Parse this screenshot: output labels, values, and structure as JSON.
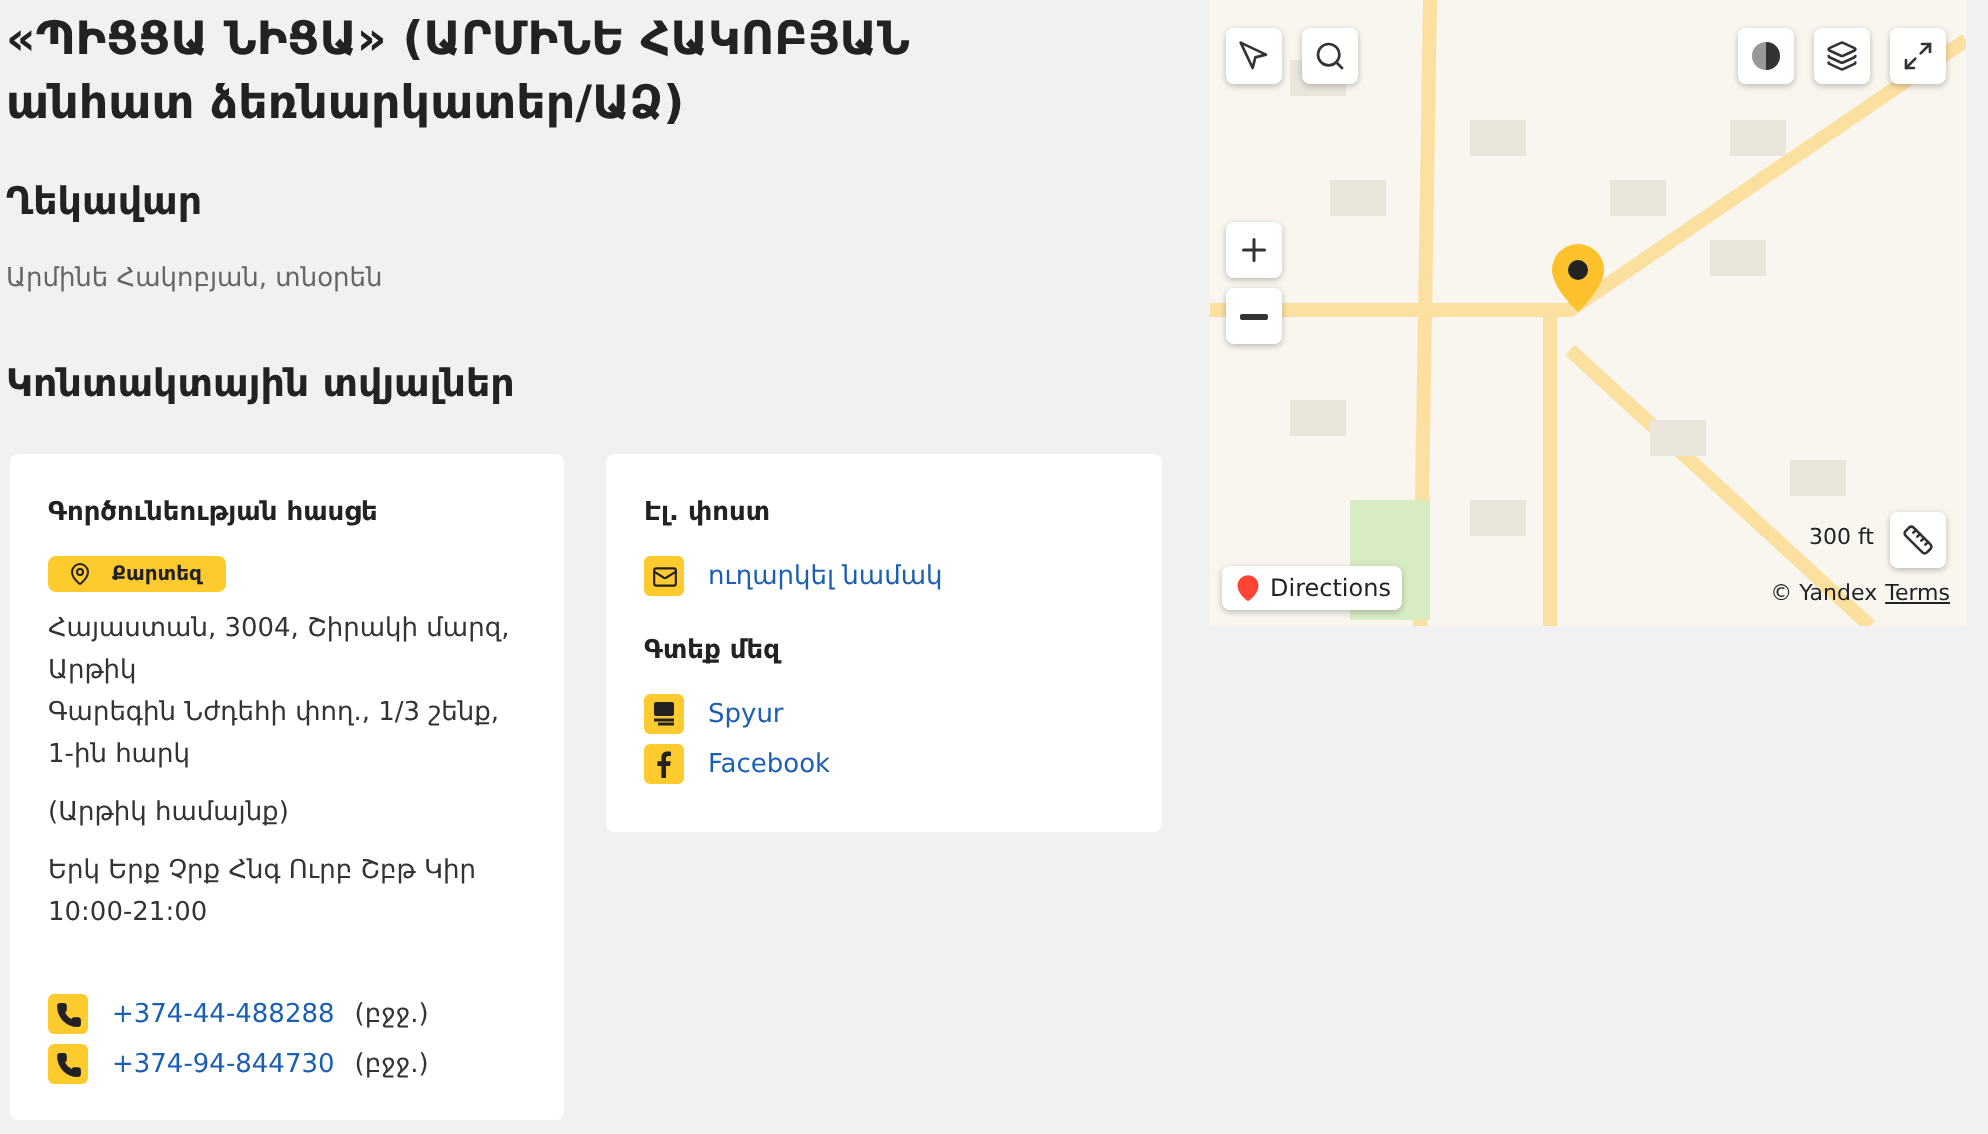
{
  "title": "«ՊԻՑՑԱ ՆԻՑԱ» (ԱՐՄԻՆԵ ՀԱԿՈԲՅԱՆ անհատ ձեռնարկատեր/ԱՁ)",
  "manager": {
    "heading": "Ղեկավար",
    "name": "Արմինե Հակոբյան, տնօրեն"
  },
  "contacts_heading": "Կոնտակտային տվյալներ",
  "address_card": {
    "heading": "Գործունեության հասցե",
    "map_button": "Քարտեզ",
    "address_lines": [
      "Հայաստան, 3004, Շիրակի մարզ, Արթիկ",
      "Գարեգին Նժդեհի փող., 1/3 շենք, 1-ին հարկ"
    ],
    "community": "(Արթիկ համայնք)",
    "days": "Երկ Երք Չրք Հնգ Ուրբ Շբթ Կիր",
    "hours": "10:00-21:00",
    "phones": [
      {
        "number": "+374-44-488288",
        "note": "(բջջ.)"
      },
      {
        "number": "+374-94-844730",
        "note": "(բջջ.)"
      }
    ]
  },
  "online_card": {
    "email_heading": "Էլ. փոստ",
    "email_link": "ուղարկել նամակ",
    "find_heading": "Գտեք մեզ",
    "links": [
      {
        "kind": "spyur",
        "label": "Spyur"
      },
      {
        "kind": "facebook",
        "label": "Facebook"
      }
    ]
  },
  "map": {
    "directions": "Directions",
    "scale": "300 ft",
    "copyright": "© Yandex",
    "terms": "Terms"
  }
}
